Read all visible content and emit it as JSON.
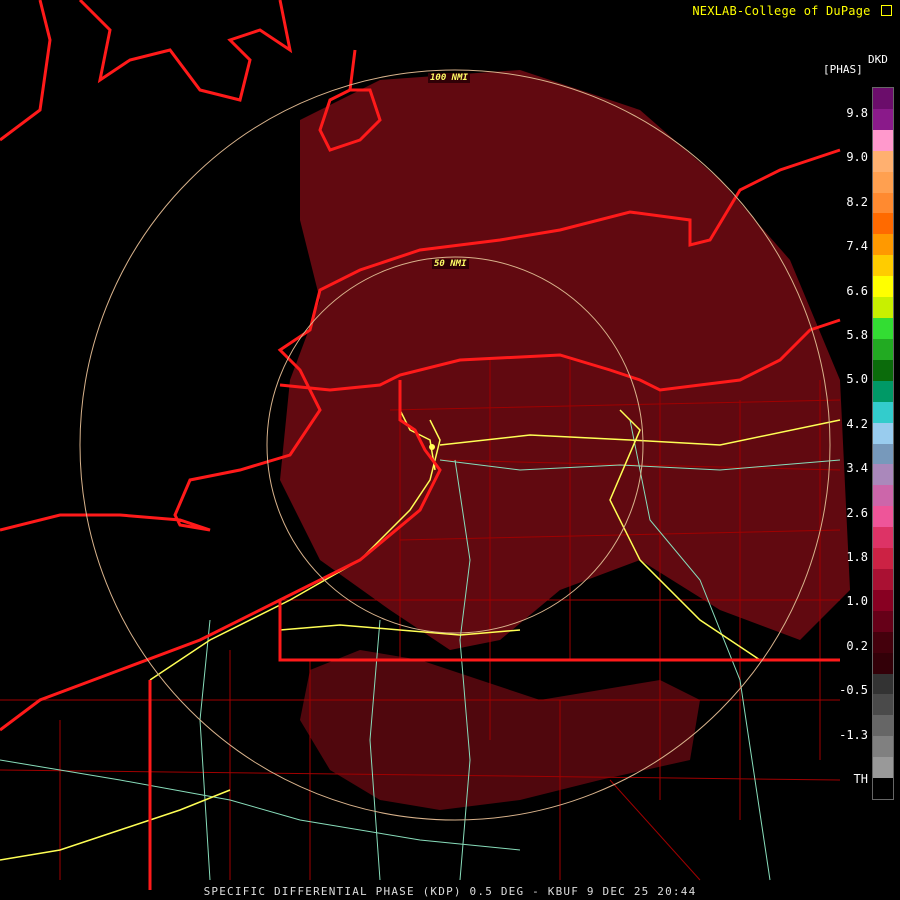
{
  "header": {
    "credit": "NEXLAB-College of DuPage",
    "credit_icon": "arrow-icon",
    "product_code": "DKD",
    "units": "[PHAS]"
  },
  "footer": {
    "caption": "SPECIFIC DIFFERENTIAL PHASE (KDP) 0.5 DEG - KBUF 9 DEC 25 20:44"
  },
  "range_rings": [
    {
      "label": "100 NMI"
    },
    {
      "label": "50 NMI"
    }
  ],
  "legend": {
    "ticks": [
      "9.8",
      "9.0",
      "8.2",
      "7.4",
      "6.6",
      "5.8",
      "5.0",
      "4.2",
      "3.4",
      "2.6",
      "1.8",
      "1.0",
      "0.2",
      "-0.5",
      "-1.3",
      "TH"
    ],
    "colors": [
      "#6b0d6b",
      "#8a1a8a",
      "#ff99cc",
      "#ffb070",
      "#ffa050",
      "#ff8a30",
      "#ff6a00",
      "#ff9900",
      "#ffcc00",
      "#ffff00",
      "#c8f000",
      "#33dd33",
      "#22aa22",
      "#0b6b0b",
      "#009966",
      "#33cccc",
      "#99ccee",
      "#7799bb",
      "#aa88bb",
      "#cc66aa",
      "#ee5599",
      "#dd3366",
      "#cc2244",
      "#aa1133",
      "#880022",
      "#660018",
      "#44000c",
      "#330008",
      "#333333",
      "#4a4a4a",
      "#666666",
      "#808080",
      "#999999",
      "#000000"
    ]
  },
  "colors": {
    "echo": "#6b0a12",
    "echo_dark": "#3a0307",
    "state_line": "#ff1a1a",
    "county_line": "#a00000",
    "interstate": "#ffff55",
    "highway": "#88ddbb",
    "ring": "#d9b38c"
  }
}
